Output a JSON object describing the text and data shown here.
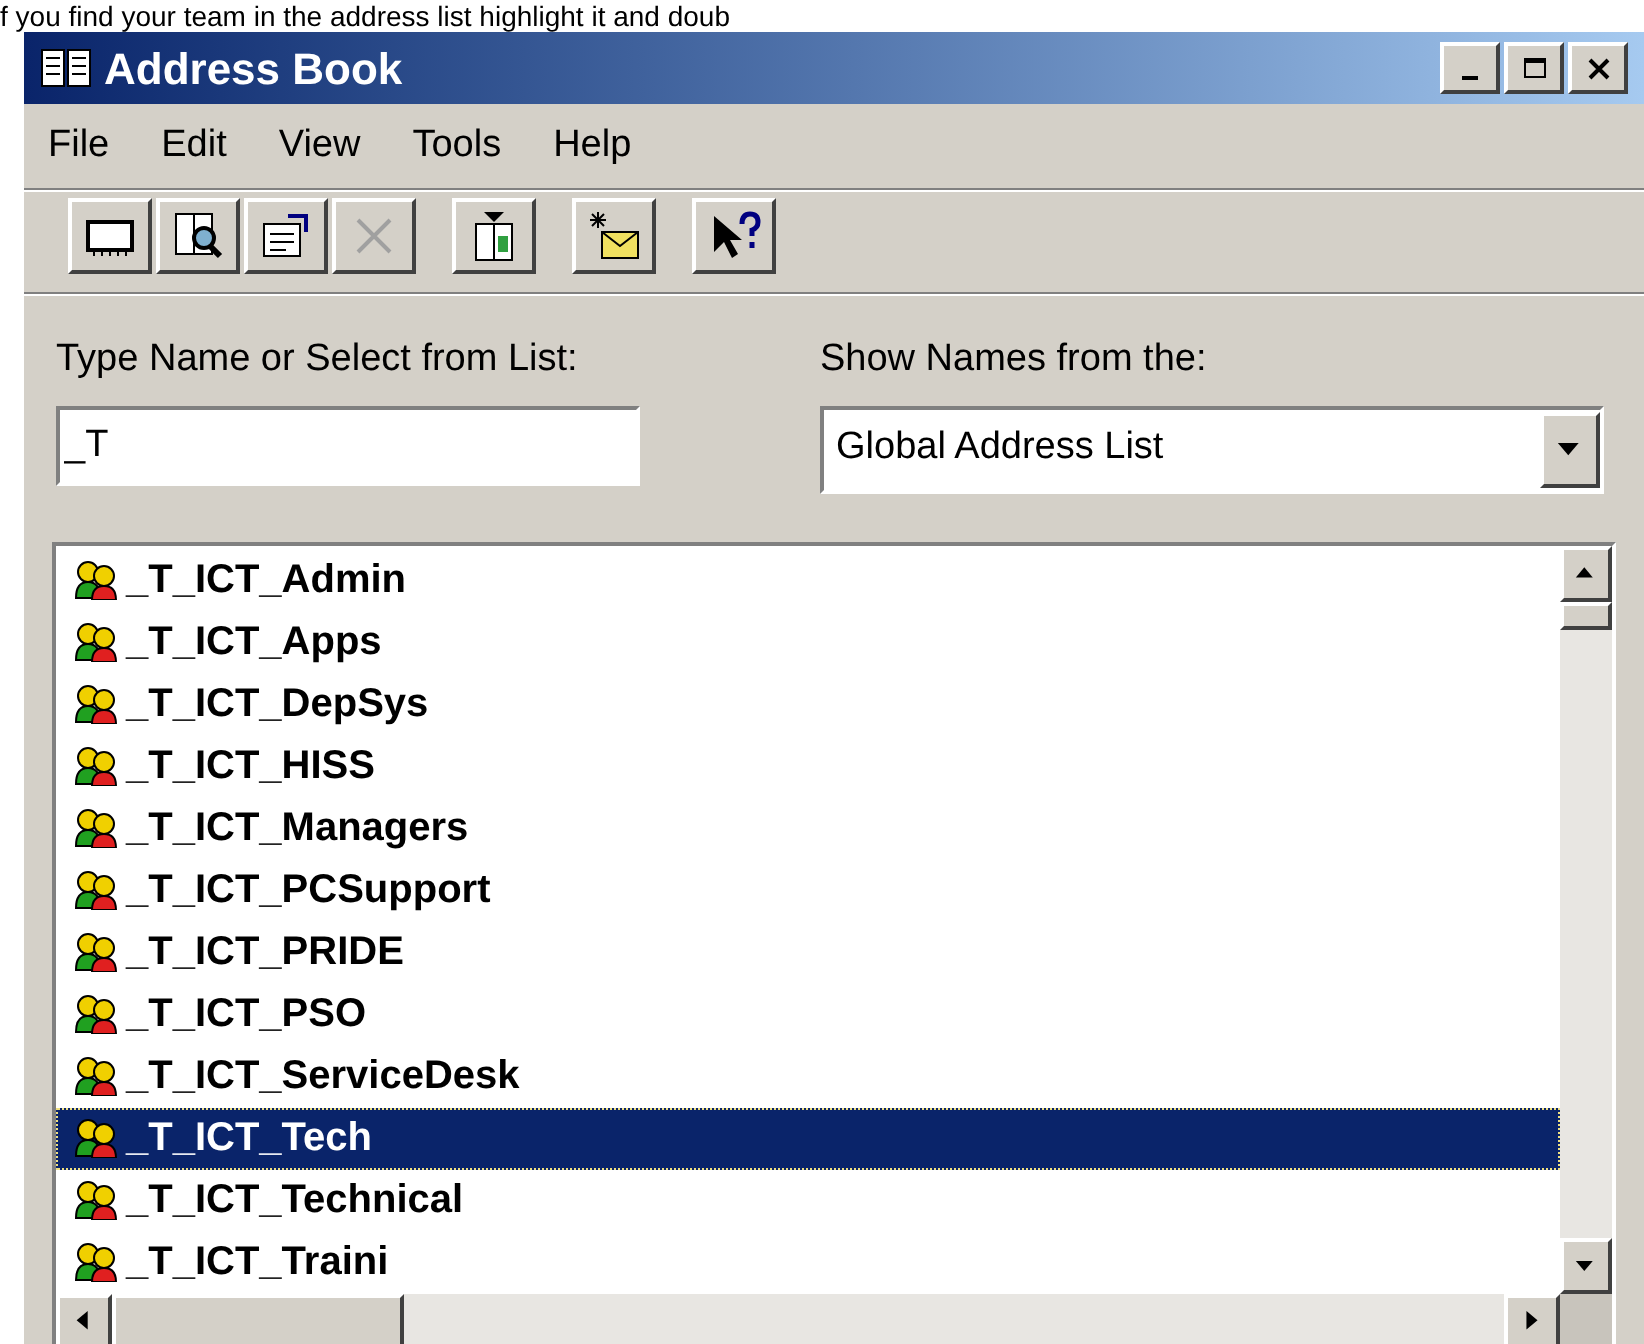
{
  "caption": "f you find your team in the address list highlight it and doub",
  "window": {
    "title": "Address Book",
    "controls": [
      {
        "kind": "minimize"
      },
      {
        "kind": "maximize"
      },
      {
        "kind": "close"
      }
    ]
  },
  "menu": [
    "File",
    "Edit",
    "View",
    "Tools",
    "Help"
  ],
  "toolbar": [
    {
      "kind": "new-entry",
      "disabled": false
    },
    {
      "kind": "find",
      "disabled": false
    },
    {
      "kind": "properties",
      "disabled": false
    },
    {
      "kind": "delete",
      "disabled": true
    },
    {
      "kind": "address-book",
      "disabled": false
    },
    {
      "kind": "send-mail",
      "disabled": false
    },
    {
      "kind": "help",
      "disabled": false
    }
  ],
  "name_field": {
    "label": "Type Name or Select from List:",
    "value": "_T"
  },
  "source_field": {
    "label": "Show Names from the:",
    "value": "Global Address List"
  },
  "entries": [
    {
      "name": "_T_ICT_Admin",
      "selected": false
    },
    {
      "name": "_T_ICT_Apps",
      "selected": false
    },
    {
      "name": "_T_ICT_DepSys",
      "selected": false
    },
    {
      "name": "_T_ICT_HISS",
      "selected": false
    },
    {
      "name": "_T_ICT_Managers",
      "selected": false
    },
    {
      "name": "_T_ICT_PCSupport",
      "selected": false
    },
    {
      "name": "_T_ICT_PRIDE",
      "selected": false
    },
    {
      "name": "_T_ICT_PSO",
      "selected": false
    },
    {
      "name": "_T_ICT_ServiceDesk",
      "selected": false
    },
    {
      "name": "_T_ICT_Tech",
      "selected": true
    },
    {
      "name": "_T_ICT_Technical",
      "selected": false
    },
    {
      "name": "_T_ICT_Traini",
      "selected": false
    }
  ]
}
